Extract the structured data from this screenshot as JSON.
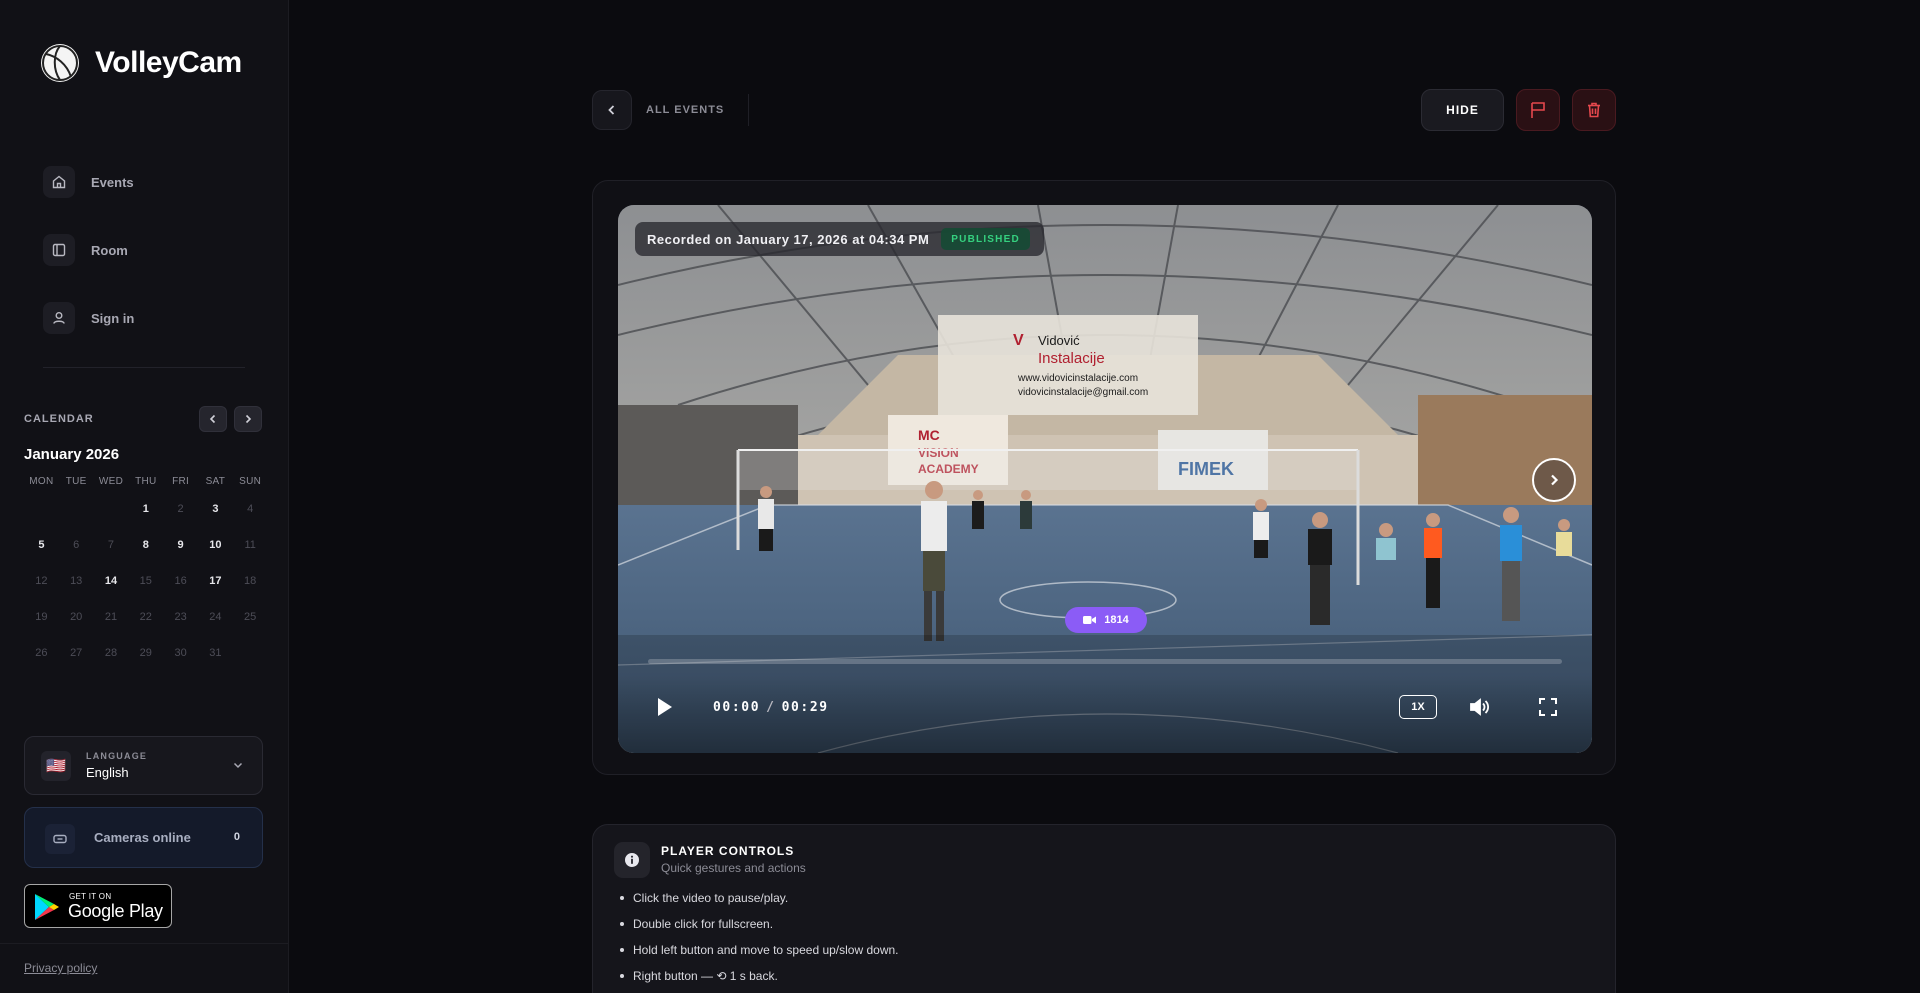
{
  "app": {
    "name": "VolleyCam"
  },
  "sidebar": {
    "nav": [
      {
        "label": "Events",
        "icon": "home-icon"
      },
      {
        "label": "Room",
        "icon": "sidebar-layout-icon"
      },
      {
        "label": "Sign in",
        "icon": "user-icon"
      }
    ],
    "calendar": {
      "title": "CALENDAR",
      "month": "January 2026",
      "weekdays": [
        "MON",
        "TUE",
        "WED",
        "THU",
        "FRI",
        "SAT",
        "SUN"
      ],
      "days": [
        {
          "d": "",
          "has": false
        },
        {
          "d": "",
          "has": false
        },
        {
          "d": "",
          "has": false
        },
        {
          "d": "1",
          "has": true
        },
        {
          "d": "2",
          "has": false
        },
        {
          "d": "3",
          "has": true
        },
        {
          "d": "4",
          "has": false
        },
        {
          "d": "5",
          "has": true
        },
        {
          "d": "6",
          "has": false
        },
        {
          "d": "7",
          "has": false
        },
        {
          "d": "8",
          "has": true
        },
        {
          "d": "9",
          "has": true
        },
        {
          "d": "10",
          "has": true
        },
        {
          "d": "11",
          "has": false
        },
        {
          "d": "12",
          "has": false
        },
        {
          "d": "13",
          "has": false
        },
        {
          "d": "14",
          "has": true
        },
        {
          "d": "15",
          "has": false
        },
        {
          "d": "16",
          "has": false
        },
        {
          "d": "17",
          "has": true
        },
        {
          "d": "18",
          "has": false
        },
        {
          "d": "19",
          "has": false
        },
        {
          "d": "20",
          "has": false
        },
        {
          "d": "21",
          "has": false
        },
        {
          "d": "22",
          "has": false
        },
        {
          "d": "23",
          "has": false
        },
        {
          "d": "24",
          "has": false
        },
        {
          "d": "25",
          "has": false
        },
        {
          "d": "26",
          "has": false
        },
        {
          "d": "27",
          "has": false
        },
        {
          "d": "28",
          "has": false
        },
        {
          "d": "29",
          "has": false
        },
        {
          "d": "30",
          "has": false
        },
        {
          "d": "31",
          "has": false
        },
        {
          "d": "",
          "has": false
        }
      ]
    },
    "language": {
      "caption": "LANGUAGE",
      "value": "English",
      "flag": "🇺🇸"
    },
    "cameras": {
      "label": "Cameras online",
      "count": "0"
    },
    "store": {
      "line1": "GET IT ON",
      "line2": "Google Play"
    },
    "privacy": "Privacy policy"
  },
  "topbar": {
    "back_label": "ALL EVENTS",
    "hide_label": "HIDE",
    "flag_icon": "flag-icon",
    "delete_icon": "trash-icon"
  },
  "video": {
    "recorded": "Recorded on January 17, 2026 at 04:34 PM",
    "status": "PUBLISHED",
    "views": "1814",
    "current_time": "00:00",
    "duration": "00:29",
    "speed": "1X",
    "progress": 0,
    "colors": {
      "status": "#35d07f",
      "views_badge": "#8b5cf6",
      "danger": "#e5484d"
    }
  },
  "help": {
    "title": "PLAYER CONTROLS",
    "subtitle": "Quick gestures and actions",
    "items": [
      "Click the video to pause/play.",
      "Double click for fullscreen.",
      "Hold left button and move to speed up/slow down.",
      "Right button — ⟲ 1 s back."
    ]
  }
}
